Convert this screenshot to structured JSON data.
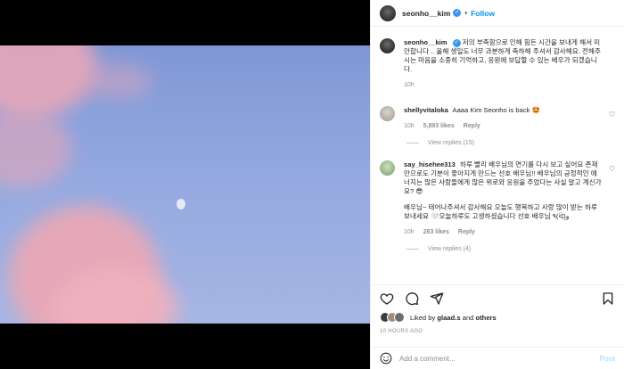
{
  "header": {
    "username": "seonho__kim",
    "separator": "•",
    "follow_label": "Follow"
  },
  "caption": {
    "username": "seonho__kim",
    "text": "저의 부족함으로 인해 힘든 시간을 보내게 해서 미안합니다 .. 올해 생일도 너무 과분하게 축하해 주셔서 감사해요. 전해주시는 마음을 소중히 기억하고, 응원에 보답할 수 있는 배우가 되겠습니다.",
    "time": "10h"
  },
  "comments": [
    {
      "username": "shellyvitaloka",
      "text": "Aaaa Kim Seonho is back 🤩",
      "time": "10h",
      "likes": "5,893 likes",
      "reply_label": "Reply",
      "view_replies": "View replies (15)"
    },
    {
      "username": "say_hisehee313",
      "text": "하루 빨리 배우님의 연기를 다시 보고 싶어요 존재만으로도 기분이 좋아지게 만드는 선호 배우님!! 배우님의 긍정적인 에너지는 많은 사람들에게 많은 위로와 응원을 주었다는 사실 알고 계신가요? 😎",
      "text2": "배우님~ 태어나주셔서 감사해요 오늘도 행복하고 사랑 많이 받는 하루 보내세요 🤍오늘하루도 고생하셨습니다 선호 배우님 ٩(ᐛ)و",
      "time": "10h",
      "likes": "263 likes",
      "reply_label": "Reply",
      "view_replies": "View replies (4)"
    }
  ],
  "likes": {
    "liked_by": "Liked by",
    "user": "glaad.s",
    "and": "and",
    "others": "others"
  },
  "time_ago": "10 HOURS AGO",
  "add_comment": {
    "placeholder": "Add a comment...",
    "post_label": "Post"
  },
  "icons": {
    "like": "heart-icon",
    "comment": "comment-icon",
    "share": "share-icon",
    "save": "bookmark-icon",
    "emoji": "emoji-icon"
  }
}
